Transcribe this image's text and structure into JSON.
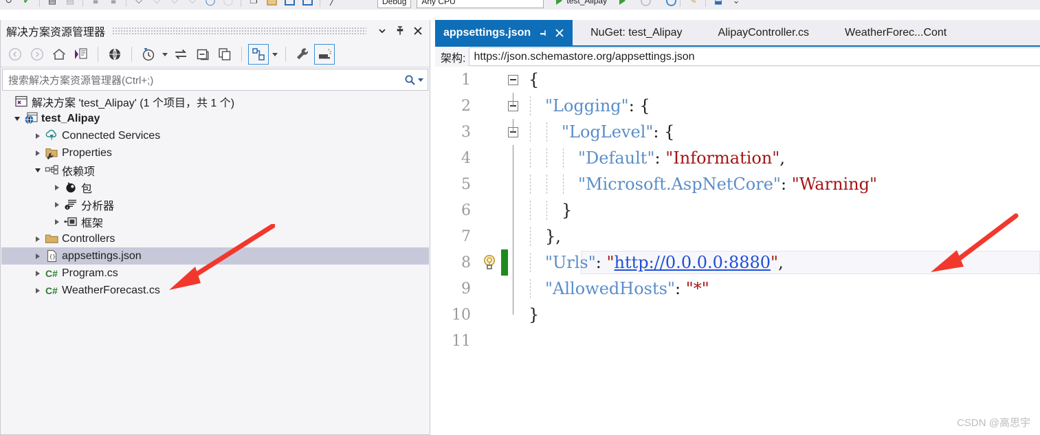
{
  "toolbar_top": {
    "configuration": "Debug",
    "platform": "Any CPU",
    "run_target": "test_Alipay",
    "icons": [
      "undo-icon",
      "redo-icon",
      "save-icon",
      "save-all-icon",
      "outdent-icon",
      "indent-icon",
      "comment-icon",
      "uncomment-icon",
      "bookmark-icon",
      "bookmark-prev-icon",
      "bookmark-next-icon",
      "bookmark-clear-icon",
      "sync-icon",
      "refresh-icon",
      "new-window-icon",
      "open-folder-icon",
      "window-icon",
      "window-split-icon",
      "pointer-icon"
    ]
  },
  "solution_explorer": {
    "title": "解决方案资源管理器",
    "header_buttons": [
      {
        "name": "chevron-down-icon",
        "glyph": "▾"
      },
      {
        "name": "pin-icon",
        "glyph": "⇱"
      },
      {
        "name": "close-icon",
        "glyph": "✕"
      }
    ],
    "toolbar": [
      {
        "name": "back-icon",
        "label": "后退"
      },
      {
        "name": "forward-icon",
        "label": "前进"
      },
      {
        "name": "home-icon",
        "label": "主页"
      },
      {
        "name": "pending-changes-icon",
        "label": "挂起的更改"
      },
      {
        "name": "globe-icon",
        "label": "切换视图"
      },
      {
        "name": "history-icon",
        "label": "文件历史"
      },
      {
        "name": "sync-with-active-document-icon",
        "label": "与活动文档同步"
      },
      {
        "name": "collapse-all-icon",
        "label": "全部折叠"
      },
      {
        "name": "show-all-files-icon",
        "label": "显示所有文件"
      },
      {
        "name": "properties-window-icon",
        "label": "属性"
      },
      {
        "name": "wrench-icon",
        "label": "工具"
      },
      {
        "name": "preview-selected-items-icon",
        "label": "预览选定项"
      }
    ],
    "search": {
      "placeholder": "搜索解决方案资源管理器(Ctrl+;)",
      "icon": "search-icon"
    },
    "tree": [
      {
        "label": "解决方案 'test_Alipay' (1 个项目，共 1 个)",
        "icon": "solution-icon",
        "indent": 0,
        "expander": "none",
        "bold": false,
        "selected": false
      },
      {
        "label": "test_Alipay",
        "icon": "web-project-icon",
        "indent": 1,
        "expander": "expanded",
        "bold": true,
        "selected": false
      },
      {
        "label": "Connected Services",
        "icon": "connected-services-icon",
        "indent": 2,
        "expander": "collapsed",
        "bold": false,
        "selected": false
      },
      {
        "label": "Properties",
        "icon": "properties-folder-icon",
        "indent": 2,
        "expander": "collapsed",
        "bold": false,
        "selected": false
      },
      {
        "label": "依赖项",
        "icon": "dependencies-icon",
        "indent": 2,
        "expander": "expanded",
        "bold": false,
        "selected": false
      },
      {
        "label": "包",
        "icon": "packages-icon",
        "indent": 3,
        "expander": "collapsed",
        "bold": false,
        "selected": false
      },
      {
        "label": "分析器",
        "icon": "analyzers-icon",
        "indent": 3,
        "expander": "collapsed",
        "bold": false,
        "selected": false
      },
      {
        "label": "框架",
        "icon": "frameworks-icon",
        "indent": 3,
        "expander": "collapsed",
        "bold": false,
        "selected": false
      },
      {
        "label": "Controllers",
        "icon": "folder-icon",
        "indent": 2,
        "expander": "collapsed",
        "bold": false,
        "selected": false
      },
      {
        "label": "appsettings.json",
        "icon": "json-file-icon",
        "indent": 2,
        "expander": "collapsed",
        "bold": false,
        "selected": true
      },
      {
        "label": "Program.cs",
        "icon": "csharp-file-icon",
        "indent": 2,
        "expander": "collapsed",
        "bold": false,
        "selected": false
      },
      {
        "label": "WeatherForecast.cs",
        "icon": "csharp-file-icon",
        "indent": 2,
        "expander": "collapsed",
        "bold": false,
        "selected": false
      }
    ]
  },
  "editor": {
    "tabs": [
      {
        "label": "appsettings.json",
        "active": true,
        "pin_icon": "pin-icon",
        "close_icon": "close-icon"
      },
      {
        "label": "NuGet: test_Alipay",
        "active": false
      },
      {
        "label": "AlipayController.cs",
        "active": false
      },
      {
        "label": "WeatherForec...Cont",
        "active": false
      }
    ],
    "schema_bar": {
      "label": "架构:",
      "value": "https://json.schemastore.org/appsettings.json"
    },
    "current_line": 8,
    "lightbulb_icon": "lightbulb-icon",
    "lines": [
      {
        "n": "1",
        "indent": 0,
        "fold": "minus",
        "tokens": [
          {
            "t": "{",
            "c": "p"
          }
        ]
      },
      {
        "n": "2",
        "indent": 1,
        "fold": "minus",
        "tokens": [
          {
            "t": "\"Logging\"",
            "c": "k"
          },
          {
            "t": ": {",
            "c": "p"
          }
        ]
      },
      {
        "n": "3",
        "indent": 2,
        "fold": "minus",
        "tokens": [
          {
            "t": "\"LogLevel\"",
            "c": "k"
          },
          {
            "t": ": {",
            "c": "p"
          }
        ]
      },
      {
        "n": "4",
        "indent": 3,
        "fold": "none",
        "tokens": [
          {
            "t": "\"Default\"",
            "c": "k"
          },
          {
            "t": ": ",
            "c": "p"
          },
          {
            "t": "\"Information\"",
            "c": "v"
          },
          {
            "t": ",",
            "c": "p"
          }
        ]
      },
      {
        "n": "5",
        "indent": 3,
        "fold": "none",
        "tokens": [
          {
            "t": "\"Microsoft.AspNetCore\"",
            "c": "k"
          },
          {
            "t": ": ",
            "c": "p"
          },
          {
            "t": "\"Warning\"",
            "c": "v"
          }
        ]
      },
      {
        "n": "6",
        "indent": 2,
        "fold": "none",
        "tokens": [
          {
            "t": "}",
            "c": "p"
          }
        ]
      },
      {
        "n": "7",
        "indent": 1,
        "fold": "none",
        "tokens": [
          {
            "t": "},",
            "c": "p"
          }
        ]
      },
      {
        "n": "8",
        "indent": 1,
        "fold": "none",
        "tokens": [
          {
            "t": "\"Urls\"",
            "c": "k"
          },
          {
            "t": ": ",
            "c": "p"
          },
          {
            "t": "\"",
            "c": "v"
          },
          {
            "t": "http://0.0.0.0:8880",
            "c": "url"
          },
          {
            "t": "\"",
            "c": "v"
          },
          {
            "t": ",",
            "c": "p"
          }
        ]
      },
      {
        "n": "9",
        "indent": 1,
        "fold": "none",
        "tokens": [
          {
            "t": "\"AllowedHosts\"",
            "c": "k"
          },
          {
            "t": ": ",
            "c": "p"
          },
          {
            "t": "\"*\"",
            "c": "v"
          }
        ]
      },
      {
        "n": "10",
        "indent": 0,
        "fold": "none",
        "tokens": [
          {
            "t": "}",
            "c": "p"
          }
        ]
      },
      {
        "n": "11",
        "indent": 0,
        "fold": "none",
        "tokens": []
      }
    ]
  },
  "annotations": {
    "arrows": [
      {
        "name": "arrow-to-appsettings-json",
        "color": "#F2382C"
      },
      {
        "name": "arrow-to-urls-line",
        "color": "#F2382C"
      }
    ]
  },
  "watermark": "CSDN @高思宇",
  "colors": {
    "accent_blue": "#0E6EB8",
    "selection": "#C7C9DA",
    "json_key": "#5A8EC8",
    "json_string": "#A31515",
    "url_link": "#1F4FD8",
    "change_bar_green": "#1C8A1C",
    "arrow_red": "#F2382C"
  }
}
